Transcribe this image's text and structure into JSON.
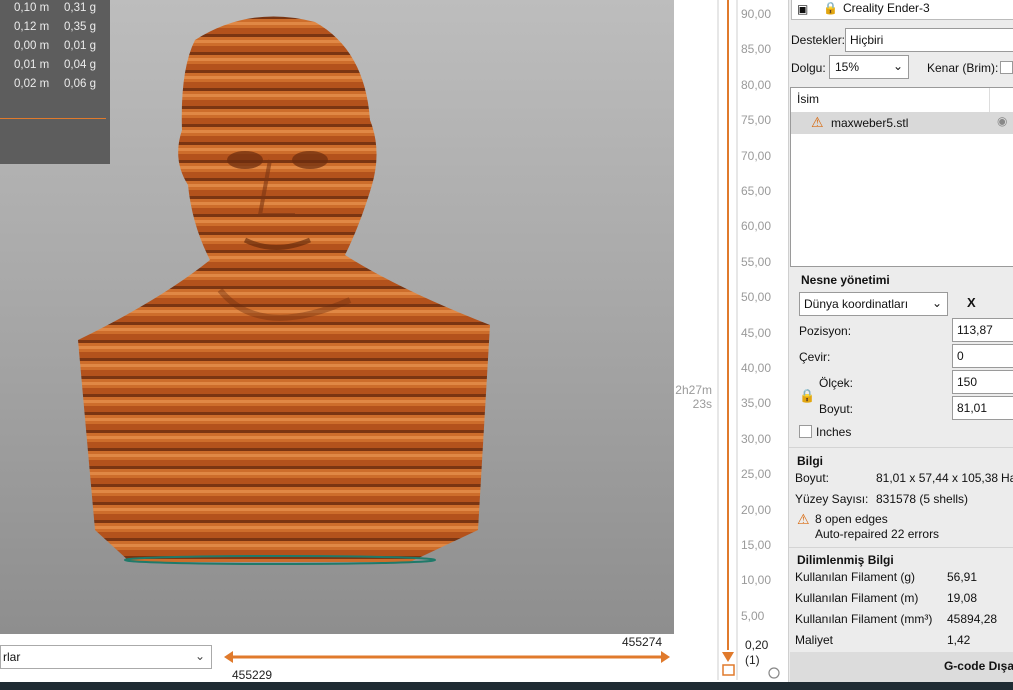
{
  "stats": {
    "rows": [
      {
        "m": "0,10 m",
        "g": "0,31 g"
      },
      {
        "m": "0,12 m",
        "g": "0,35 g"
      },
      {
        "m": "0,00 m",
        "g": "0,01 g"
      },
      {
        "m": "0,01 m",
        "g": "0,04 g"
      },
      {
        "m": "0,02 m",
        "g": "0,06 g"
      }
    ]
  },
  "view_combo": {
    "value": "rlar"
  },
  "layer_slider": {
    "labels": [
      "90,00",
      "85,00",
      "80,00",
      "75,00",
      "70,00",
      "65,00",
      "60,00",
      "55,00",
      "50,00",
      "45,00",
      "40,00",
      "35,00",
      "30,00",
      "25,00",
      "20,00",
      "15,00",
      "10,00",
      "5,00"
    ],
    "bottom_value": "0,20",
    "bottom_index": "(1)",
    "print_time_1": "2h27m",
    "print_time_2": "23s"
  },
  "move_slider": {
    "start": "455229",
    "end": "455274"
  },
  "panel": {
    "printer_name": "Creality Ender-3",
    "supports_label": "Destekler:",
    "supports_value": "Hiçbiri",
    "infill_label": "Dolgu:",
    "infill_value": "15%",
    "brim_label": "Kenar (Brim):",
    "list_header": "İsim",
    "object_name": "maxweber5.stl",
    "object_mgmt_title": "Nesne yönetimi",
    "coord_system": "Dünya koordinatları",
    "axis_x": "X",
    "position_label": "Pozisyon:",
    "position_value": "113,87",
    "rotate_label": "Çevir:",
    "rotate_value": "0",
    "scale_label": "Ölçek:",
    "scale_value": "150",
    "size_label": "Boyut:",
    "size_value": "81,01",
    "inches_label": "Inches",
    "info_title": "Bilgi",
    "info_size_label": "Boyut:",
    "info_size_value": "81,01 x 57,44 x 105,38",
    "info_size_extra": "Ha",
    "faces_label": "Yüzey Sayısı:",
    "faces_value": "831578 (5 shells)",
    "open_edges": "8 open edges",
    "auto_repaired": "Auto-repaired 22 errors",
    "sliced_title": "Dilimlenmiş Bilgi",
    "fil_g_label": "Kullanılan Filament (g)",
    "fil_g_value": "56,91",
    "fil_m_label": "Kullanılan Filament (m)",
    "fil_m_value": "19,08",
    "fil_mm3_label": "Kullanılan Filament (mm³)",
    "fil_mm3_value": "45894,28",
    "cost_label": "Maliyet",
    "cost_value": "1,42",
    "gcode_button": "G-code Dışa"
  },
  "colors": {
    "accent": "#e07a2c",
    "model": "#c9692a",
    "panel_bg": "#ececec"
  }
}
